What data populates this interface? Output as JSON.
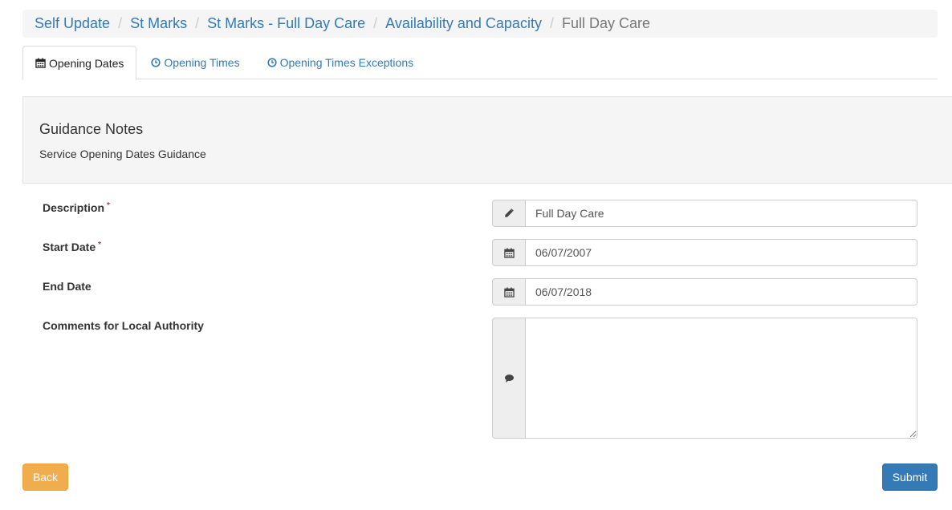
{
  "breadcrumb": {
    "items": [
      "Self Update",
      "St Marks",
      "St Marks - Full Day Care",
      "Availability and Capacity"
    ],
    "separator": "/",
    "active": "Full Day Care"
  },
  "tabs": [
    {
      "label": "Opening Dates",
      "icon": "calendar-icon",
      "active": true
    },
    {
      "label": "Opening Times",
      "icon": "clock-icon",
      "active": false
    },
    {
      "label": "Opening Times Exceptions",
      "icon": "clock-icon",
      "active": false
    }
  ],
  "guidance": {
    "title": "Guidance Notes",
    "text": "Service Opening Dates Guidance"
  },
  "form": {
    "description": {
      "label": "Description",
      "required_mark": "*",
      "value": "Full Day Care",
      "icon": "pencil-icon"
    },
    "start_date": {
      "label": "Start Date",
      "required_mark": "*",
      "value": "06/07/2007",
      "icon": "calendar-icon"
    },
    "end_date": {
      "label": "End Date",
      "value": "06/07/2018",
      "icon": "calendar-icon"
    },
    "comments": {
      "label": "Comments for Local Authority",
      "value": "",
      "icon": "comment-icon"
    }
  },
  "buttons": {
    "back": "Back",
    "submit": "Submit"
  },
  "colors": {
    "link": "#337ab7",
    "warning": "#f0ad4e",
    "primary": "#337ab7",
    "required": "#a94442"
  }
}
